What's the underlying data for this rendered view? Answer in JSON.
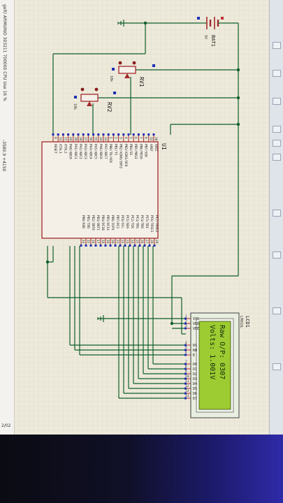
{
  "status_bar": {
    "text": "geR) ARMUINO 303211 700000 CPU Use 16 %",
    "coordinates": "-3580.9   +4150",
    "page_indicator": "2/02"
  },
  "colors": {
    "wire": "#0d5e2a",
    "component_border": "#a3292b",
    "component_fill": "#f4f0e8",
    "pin_blue": "#1e2fb5",
    "lcd_screen": "#9ccc31",
    "lcd_text": "#132a10",
    "grid_bg": "#eeeadb"
  },
  "battery": {
    "label": "BAT1",
    "value": "9V"
  },
  "rv1": {
    "label": "RV1",
    "value": "10k"
  },
  "rv2": {
    "label": "RV2",
    "value": "10k"
  },
  "u1": {
    "label": "U1",
    "left_pins": [
      {
        "num": "9",
        "name": "RESET"
      },
      {
        "num": "13",
        "name": "XTAL1"
      },
      {
        "num": "12",
        "name": "XTAL2"
      },
      {
        "num": "40",
        "name": "PA0/ADC0"
      },
      {
        "num": "39",
        "name": "PA1/ADC1"
      },
      {
        "num": "38",
        "name": "PA2/ADC2"
      },
      {
        "num": "37",
        "name": "PA3/ADC3"
      },
      {
        "num": "36",
        "name": "PA4/ADC4"
      },
      {
        "num": "35",
        "name": "PA5/ADC5"
      },
      {
        "num": "34",
        "name": "PA6/ADC6"
      },
      {
        "num": "33",
        "name": "PA7/ADC7"
      },
      {
        "num": "1",
        "name": "PB0/T0/XCK"
      },
      {
        "num": "2",
        "name": "PB1/T1"
      },
      {
        "num": "3",
        "name": "PB2/AIN0/INT2"
      },
      {
        "num": "4",
        "name": "PB3/AIN1/OC0"
      },
      {
        "num": "5",
        "name": "PB4/SS"
      },
      {
        "num": "6",
        "name": "PB5/MOSI"
      },
      {
        "num": "7",
        "name": "PB6/MISO"
      },
      {
        "num": "8",
        "name": "PB7/SCK"
      },
      {
        "num": "32",
        "name": "AREF"
      },
      {
        "num": "30",
        "name": "AVCC"
      }
    ],
    "right_pins": [
      {
        "num": "14",
        "name": "PD0/RXD"
      },
      {
        "num": "15",
        "name": "PD1/TXD"
      },
      {
        "num": "16",
        "name": "PD2/INT0"
      },
      {
        "num": "17",
        "name": "PD3/INT1"
      },
      {
        "num": "18",
        "name": "PD4/OC1B"
      },
      {
        "num": "19",
        "name": "PD5/OC1A"
      },
      {
        "num": "20",
        "name": "PD6/ICP1"
      },
      {
        "num": "21",
        "name": "PD7/OC2"
      },
      {
        "num": "22",
        "name": "PC0/SCL"
      },
      {
        "num": "23",
        "name": "PC1/SDA"
      },
      {
        "num": "24",
        "name": "PC2/TCK"
      },
      {
        "num": "25",
        "name": "PC3/TMS"
      },
      {
        "num": "26",
        "name": "PC4/TDO"
      },
      {
        "num": "27",
        "name": "PC5/TDI"
      },
      {
        "num": "28",
        "name": "PC6/TOSC1"
      },
      {
        "num": "29",
        "name": "PC7/TOSC2"
      }
    ]
  },
  "lcd": {
    "label": "LCD1",
    "model": "LM016L",
    "line1": "Raw O/P: 0307",
    "line2": "Volts: 1.001V",
    "pins": [
      {
        "num": "1",
        "name": "VSS"
      },
      {
        "num": "2",
        "name": "VDD"
      },
      {
        "num": "3",
        "name": "VEE"
      },
      {
        "num": "4",
        "name": "RS"
      },
      {
        "num": "5",
        "name": "RW"
      },
      {
        "num": "6",
        "name": "E"
      },
      {
        "num": "7",
        "name": "D0"
      },
      {
        "num": "8",
        "name": "D1"
      },
      {
        "num": "9",
        "name": "D2"
      },
      {
        "num": "10",
        "name": "D3"
      },
      {
        "num": "11",
        "name": "D4"
      },
      {
        "num": "12",
        "name": "D5"
      },
      {
        "num": "13",
        "name": "D6"
      },
      {
        "num": "14",
        "name": "D7"
      }
    ]
  }
}
